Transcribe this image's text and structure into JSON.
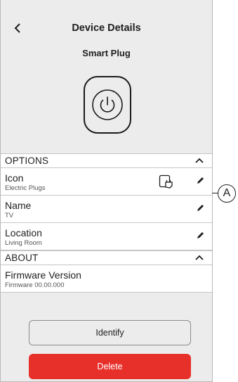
{
  "header": {
    "back_icon": "chevron-left-icon",
    "title": "Device Details",
    "device_name": "Smart Plug"
  },
  "power_icon": "power-icon",
  "options": {
    "header": "OPTIONS",
    "rows": [
      {
        "title": "Icon",
        "subtitle": "Electric Plugs",
        "icon": "plug-icon"
      },
      {
        "title": "Name",
        "subtitle": "TV"
      },
      {
        "title": "Location",
        "subtitle": "Living Room"
      }
    ]
  },
  "about": {
    "header": "ABOUT",
    "rows": [
      {
        "title": "Firmware Version",
        "subtitle": "Firmware 00.00.000"
      }
    ]
  },
  "buttons": {
    "identify": "Identify",
    "delete": "Delete"
  },
  "annotation": {
    "label": "A"
  },
  "colors": {
    "background": "#ececec",
    "delete": "#e8302b",
    "text": "#1e1e1e"
  }
}
